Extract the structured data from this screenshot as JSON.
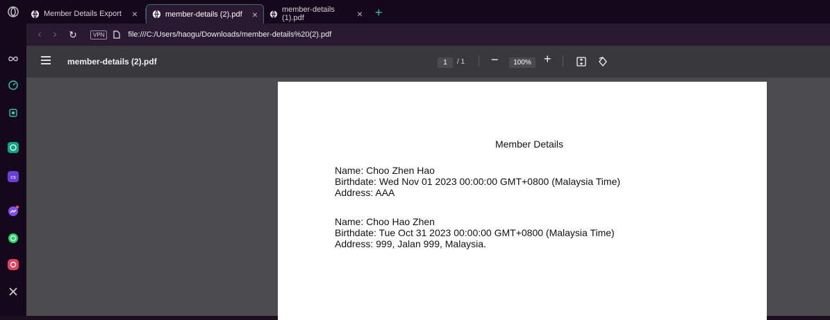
{
  "browser": {
    "tabs": [
      {
        "label": "Member Details Export",
        "active": false
      },
      {
        "label": "member-details (2).pdf",
        "active": true
      },
      {
        "label": "member-details (1).pdf",
        "active": false
      }
    ],
    "address": {
      "vpn_label": "VPN",
      "url": "file:///C:/Users/haogu/Downloads/member-details%20(2).pdf"
    },
    "sidebar_icons": [
      "aria-icon",
      "speed-dial-icon",
      "extensions-icon",
      "chatgpt-icon",
      "cs-app-icon",
      "messenger-icon",
      "whatsapp-icon",
      "instagram-icon",
      "x-icon"
    ],
    "accent_color": "#2ec5b0"
  },
  "pdf_viewer": {
    "document_title": "member-details (2).pdf",
    "page_current": "1",
    "page_total": "/ 1",
    "zoom": "100%"
  },
  "document": {
    "heading": "Member Details",
    "records": [
      {
        "name": "Name: Choo Zhen Hao",
        "birthdate": "Birthdate: Wed Nov 01 2023 00:00:00 GMT+0800 (Malaysia Time)",
        "address": "Address: AAA"
      },
      {
        "name": "Name: Choo Hao Zhen",
        "birthdate": "Birthdate: Tue Oct 31 2023 00:00:00 GMT+0800 (Malaysia Time)",
        "address": "Address: 999, Jalan 999, Malaysia."
      }
    ]
  }
}
